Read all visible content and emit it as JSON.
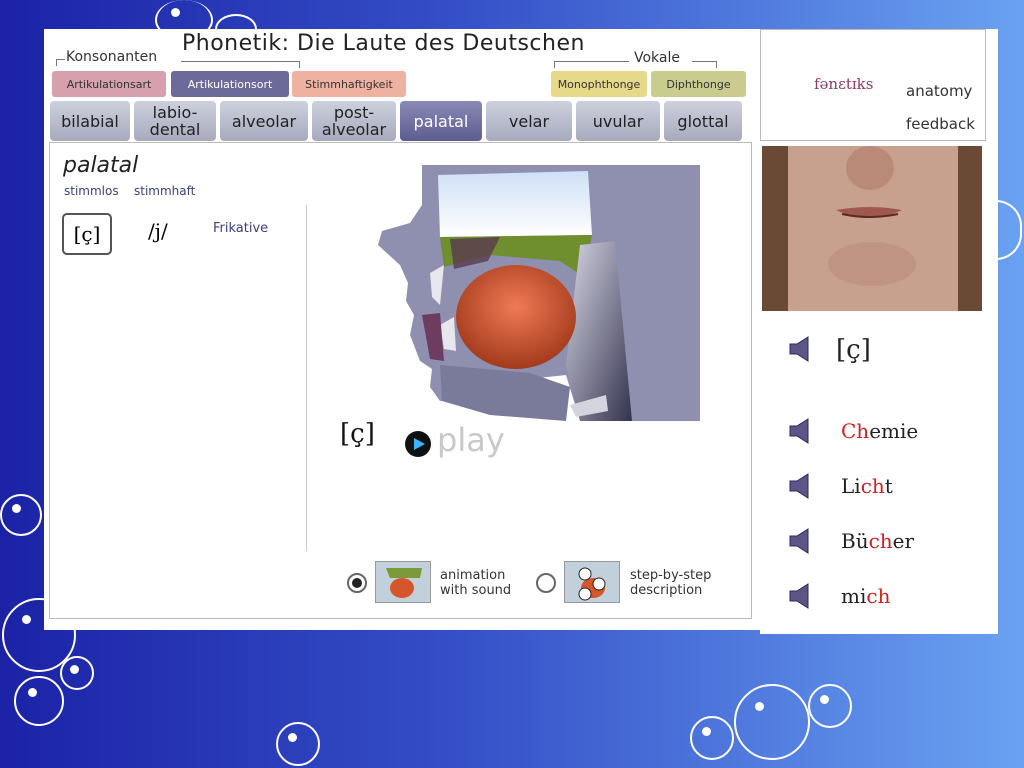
{
  "header": {
    "title": "Phonetik:  Die Laute des Deutschen",
    "consonants_label": "Konsonanten",
    "vowels_label": "Vokale"
  },
  "feature_tabs": [
    {
      "label": "Artikulationsart",
      "color": "#d6a0ad"
    },
    {
      "label": "Artikulationsort",
      "color": "#6b6a98"
    },
    {
      "label": "Stimmhaftigkeit",
      "color": "#f0b2a0"
    },
    {
      "label": "Monophthonge",
      "color": "#e7d98a"
    },
    {
      "label": "Diphthonge",
      "color": "#c9cc8e"
    }
  ],
  "place_tabs": [
    "bilabial",
    "labio-\ndental",
    "alveolar",
    "post-\nalveolar",
    "palatal",
    "velar",
    "uvular",
    "glottal"
  ],
  "active_place": "palatal",
  "content": {
    "place_name": "palatal",
    "voiceless": "stimmlos",
    "voiced": "stimmhaft",
    "symbol_voiceless": "[ç]",
    "symbol_voiced": "/j/",
    "manner": "Frikative",
    "ipa_display": "[ç]",
    "play_label": "play",
    "option_animation": "animation\nwith sound",
    "option_steps": "step-by-step\ndescription",
    "selected_option": "animation"
  },
  "right_panel": {
    "logo_text": "fənɛtɪks",
    "nav_anatomy": "anatomy",
    "nav_feedback": "feedback",
    "sound_symbol": "[ç]",
    "words": [
      {
        "pre": "",
        "hl": "Ch",
        "post": "emie"
      },
      {
        "pre": "Li",
        "hl": "ch",
        "post": "t"
      },
      {
        "pre": "Bü",
        "hl": "ch",
        "post": "er"
      },
      {
        "pre": "mi",
        "hl": "ch",
        "post": ""
      }
    ]
  },
  "colors": {
    "highlight": "#d21e1e",
    "active_tab": "#5d5c8f",
    "background": "#3550c8"
  }
}
